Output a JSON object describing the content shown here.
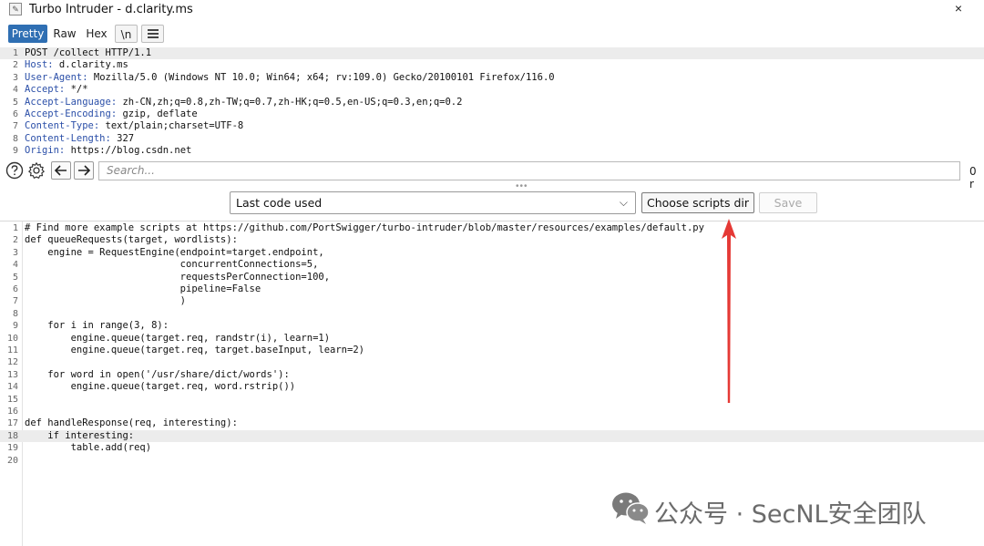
{
  "window": {
    "title": "Turbo Intruder - d.clarity.ms",
    "close_glyph": "×"
  },
  "format_tabs": [
    {
      "label": "Pretty",
      "active": true
    },
    {
      "label": "Raw",
      "active": false
    },
    {
      "label": "Hex",
      "active": false
    },
    {
      "label": "\\n",
      "active": false
    }
  ],
  "request_lines": [
    {
      "n": "1",
      "name": "",
      "value": "POST /collect HTTP/1.1"
    },
    {
      "n": "2",
      "name": "Host:",
      "value": " d.clarity.ms"
    },
    {
      "n": "3",
      "name": "User-Agent:",
      "value": " Mozilla/5.0 (Windows NT 10.0; Win64; x64; rv:109.0) Gecko/20100101 Firefox/116.0"
    },
    {
      "n": "4",
      "name": "Accept:",
      "value": " */*"
    },
    {
      "n": "5",
      "name": "Accept-Language:",
      "value": " zh-CN,zh;q=0.8,zh-TW;q=0.7,zh-HK;q=0.5,en-US;q=0.3,en;q=0.2"
    },
    {
      "n": "6",
      "name": "Accept-Encoding:",
      "value": " gzip, deflate"
    },
    {
      "n": "7",
      "name": "Content-Type:",
      "value": " text/plain;charset=UTF-8"
    },
    {
      "n": "8",
      "name": "Content-Length:",
      "value": " 327"
    },
    {
      "n": "9",
      "name": "Origin:",
      "value": " https://blog.csdn.net"
    }
  ],
  "search": {
    "placeholder": "Search...",
    "matches": "0 r"
  },
  "script_controls": {
    "selected_script": "Last code used",
    "choose_dir_label": "Choose scripts dir",
    "save_label": "Save"
  },
  "script_lines": [
    {
      "n": "1",
      "text": "# Find more example scripts at https://github.com/PortSwigger/turbo-intruder/blob/master/resources/examples/default.py"
    },
    {
      "n": "2",
      "text": "def queueRequests(target, wordlists):"
    },
    {
      "n": "3",
      "text": "    engine = RequestEngine(endpoint=target.endpoint,"
    },
    {
      "n": "4",
      "text": "                           concurrentConnections=5,"
    },
    {
      "n": "5",
      "text": "                           requestsPerConnection=100,"
    },
    {
      "n": "6",
      "text": "                           pipeline=False"
    },
    {
      "n": "7",
      "text": "                           )"
    },
    {
      "n": "8",
      "text": ""
    },
    {
      "n": "9",
      "text": "    for i in range(3, 8):"
    },
    {
      "n": "10",
      "text": "        engine.queue(target.req, randstr(i), learn=1)"
    },
    {
      "n": "11",
      "text": "        engine.queue(target.req, target.baseInput, learn=2)"
    },
    {
      "n": "12",
      "text": ""
    },
    {
      "n": "13",
      "text": "    for word in open('/usr/share/dict/words'):"
    },
    {
      "n": "14",
      "text": "        engine.queue(target.req, word.rstrip())"
    },
    {
      "n": "15",
      "text": ""
    },
    {
      "n": "16",
      "text": ""
    },
    {
      "n": "17",
      "text": "def handleResponse(req, interesting):"
    },
    {
      "n": "18",
      "text": "    if interesting:"
    },
    {
      "n": "19",
      "text": "        table.add(req)"
    },
    {
      "n": "20",
      "text": ""
    }
  ],
  "watermark": {
    "text": "公众号 · SecNL安全团队"
  },
  "colors": {
    "accent": "#2f6fb3",
    "annotation_arrow": "#e53935",
    "header_name": "#2b4fa8"
  },
  "icons": [
    "app-icon",
    "help-icon",
    "settings-gear-icon",
    "back-arrow-icon",
    "forward-arrow-icon",
    "menu-icon",
    "chevron-down-icon",
    "wechat-logo-icon"
  ]
}
